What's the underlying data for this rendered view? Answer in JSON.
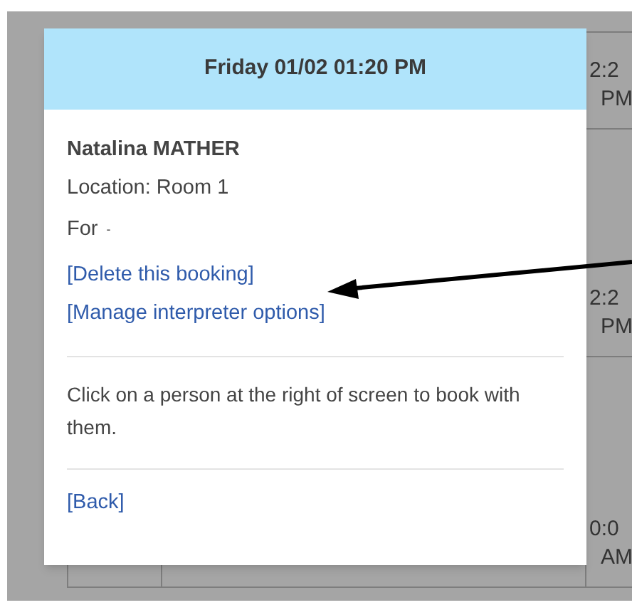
{
  "background": {
    "time_slots": [
      {
        "time": "2:2",
        "period": "PM"
      },
      {
        "time": "2:2",
        "period": "PM"
      },
      {
        "time": "0:0",
        "period": "AM"
      }
    ]
  },
  "popup": {
    "title": "Friday 01/02 01:20 PM",
    "name": "Natalina MATHER",
    "location": "Location: Room 1",
    "for_label": "For",
    "for_value": "-",
    "links": [
      "[Delete this booking]",
      "[Manage interpreter options]"
    ],
    "instruction": "Click on a person at the right of screen to book with them.",
    "back_link": "[Back]"
  }
}
